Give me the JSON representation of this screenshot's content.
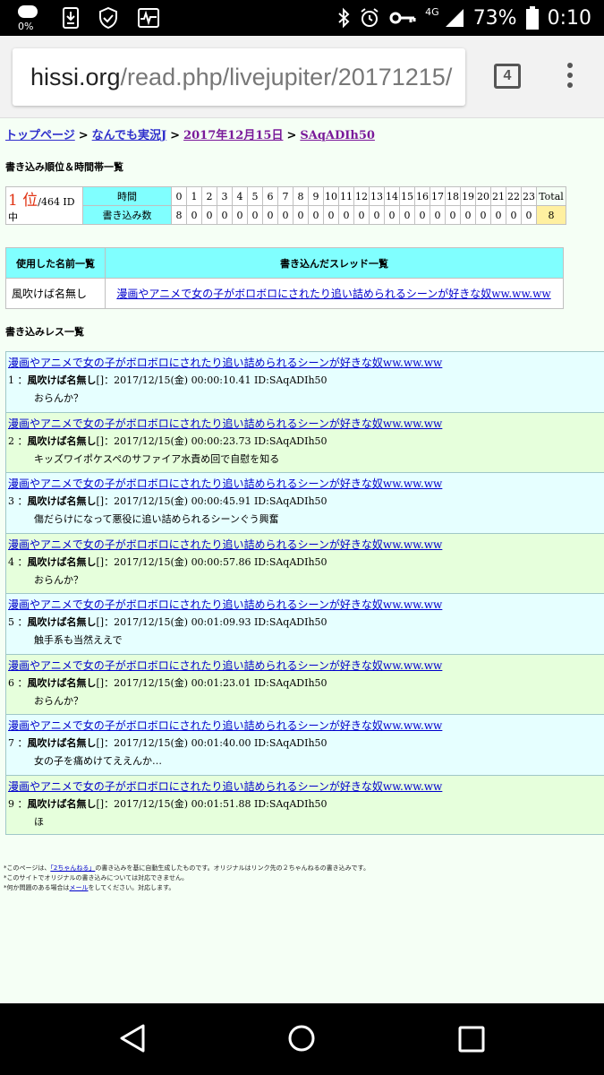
{
  "status_bar": {
    "weather_pct": "0%",
    "network": "4G",
    "battery": "73%",
    "time": "0:10"
  },
  "browser": {
    "url_host": "hissi.org",
    "url_path": "/read.php/livejupiter/20171215/",
    "tab_count": "4"
  },
  "breadcrumb": {
    "items": [
      "トップページ",
      "なんでも実況J",
      "2017年12月15日",
      "SAqADIh50"
    ],
    "separator": ">"
  },
  "rank_section": {
    "heading": "書き込み順位＆時間帯一覧",
    "rank_num": "1 位",
    "rank_suffix": "/464 ID中",
    "row_label_time": "時間",
    "row_label_count": "書き込み数",
    "hours": [
      "0",
      "1",
      "2",
      "3",
      "4",
      "5",
      "6",
      "7",
      "8",
      "9",
      "10",
      "11",
      "12",
      "13",
      "14",
      "15",
      "16",
      "17",
      "18",
      "19",
      "20",
      "21",
      "22",
      "23",
      "Total"
    ],
    "counts": [
      "8",
      "0",
      "0",
      "0",
      "0",
      "0",
      "0",
      "0",
      "0",
      "0",
      "0",
      "0",
      "0",
      "0",
      "0",
      "0",
      "0",
      "0",
      "0",
      "0",
      "0",
      "0",
      "0",
      "0",
      "8"
    ]
  },
  "names_threads": {
    "col_names": "使用した名前一覧",
    "col_threads": "書き込んだスレッド一覧",
    "name": "風吹けば名無し",
    "thread": "漫画やアニメで女の子がボロボロにされたり追い詰められるシーンが好きな奴ww.ww.ww"
  },
  "posts_section": {
    "heading": "書き込みレス一覧",
    "posts": [
      {
        "thread": "漫画やアニメで女の子がボロボロにされたり追い詰められるシーンが好きな奴ww.ww.ww",
        "num": "1 ：",
        "name": "風吹けば名無し",
        "info": "[]：2017/12/15(金) 00:00:10.41 ID:SAqADIh50",
        "body": "おらんか？"
      },
      {
        "thread": "漫画やアニメで女の子がボロボロにされたり追い詰められるシーンが好きな奴ww.ww.ww",
        "num": "2 ：",
        "name": "風吹けば名無し",
        "info": "[]：2017/12/15(金) 00:00:23.73 ID:SAqADIh50",
        "body": "キッズワイポケスペのサファイア水責め回で自慰を知る"
      },
      {
        "thread": "漫画やアニメで女の子がボロボロにされたり追い詰められるシーンが好きな奴ww.ww.ww",
        "num": "3 ：",
        "name": "風吹けば名無し",
        "info": "[]：2017/12/15(金) 00:00:45.91 ID:SAqADIh50",
        "body": "傷だらけになって悪役に追い詰められるシーンぐう興奮"
      },
      {
        "thread": "漫画やアニメで女の子がボロボロにされたり追い詰められるシーンが好きな奴ww.ww.ww",
        "num": "4 ：",
        "name": "風吹けば名無し",
        "info": "[]：2017/12/15(金) 00:00:57.86 ID:SAqADIh50",
        "body": "おらんか？"
      },
      {
        "thread": "漫画やアニメで女の子がボロボロにされたり追い詰められるシーンが好きな奴ww.ww.ww",
        "num": "5 ：",
        "name": "風吹けば名無し",
        "info": "[]：2017/12/15(金) 00:01:09.93 ID:SAqADIh50",
        "body": "触手系も当然ええで"
      },
      {
        "thread": "漫画やアニメで女の子がボロボロにされたり追い詰められるシーンが好きな奴ww.ww.ww",
        "num": "6 ：",
        "name": "風吹けば名無し",
        "info": "[]：2017/12/15(金) 00:01:23.01 ID:SAqADIh50",
        "body": "おらんか？"
      },
      {
        "thread": "漫画やアニメで女の子がボロボロにされたり追い詰められるシーンが好きな奴ww.ww.ww",
        "num": "7 ：",
        "name": "風吹けば名無し",
        "info": "[]：2017/12/15(金) 00:01:40.00 ID:SAqADIh50",
        "body": "女の子を痛めけてええんか…"
      },
      {
        "thread": "漫画やアニメで女の子がボロボロにされたり追い詰められるシーンが好きな奴ww.ww.ww",
        "num": "9 ：",
        "name": "風吹けば名無し",
        "info": "[]：2017/12/15(金) 00:01:51.88 ID:SAqADIh50",
        "body": "ほ"
      }
    ]
  },
  "footnotes": {
    "line1_pre": "*このページは、",
    "line1_link": "「2ちゃんねる」",
    "line1_post": "の書き込みを基に自動生成したものです。オリジナルはリンク先の２ちゃんねるの書き込みです。",
    "line2": "*このサイトでオリジナルの書き込みについては対応できません。",
    "line3_pre": "*何か問題のある場合は",
    "line3_link": "メール",
    "line3_post": "をしてください。対応します。"
  },
  "colors": {
    "header_cyan": "#80ffff",
    "count_yellow": "#fff0a0",
    "post_bg_a": "#e6ffff",
    "post_bg_b": "#e6ffdc",
    "link": "#0000cc",
    "rank_red": "#e03010"
  },
  "nav_icons": [
    "back-icon",
    "home-icon",
    "recents-icon"
  ]
}
